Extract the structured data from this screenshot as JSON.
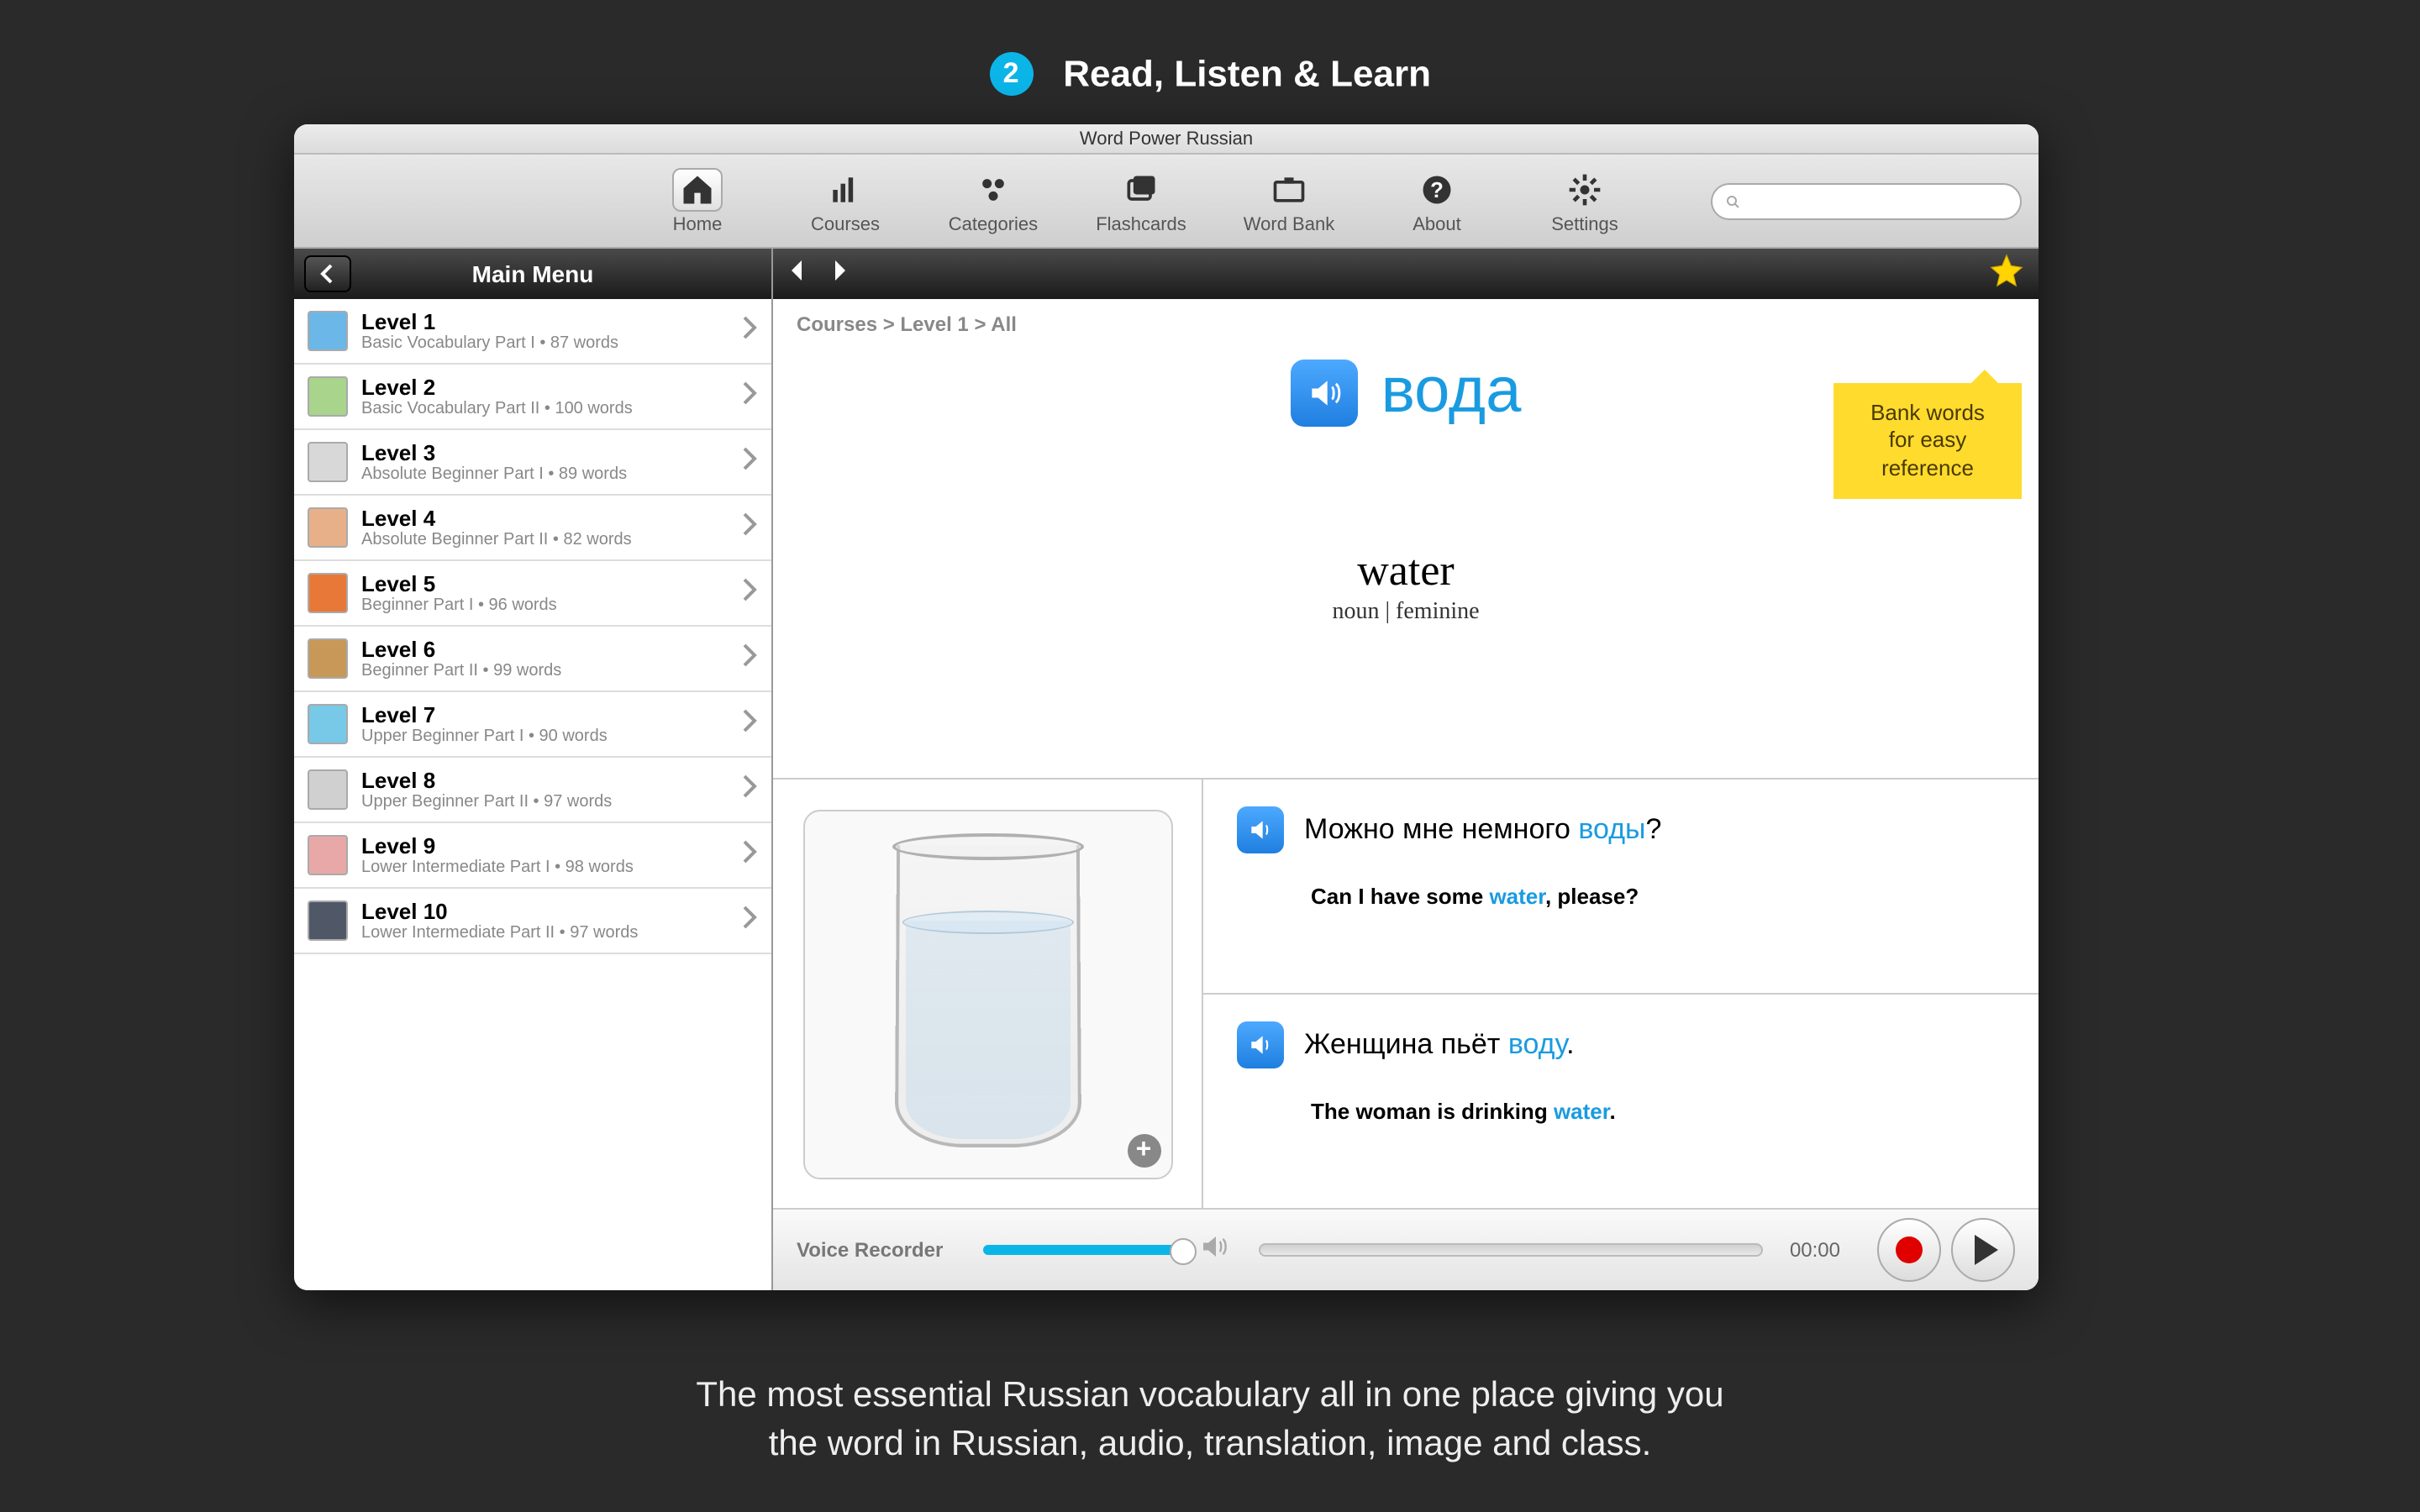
{
  "hero": {
    "step_number": "2",
    "title": "Read, Listen & Learn",
    "footer_line1": "The most essential Russian vocabulary all in one place giving you",
    "footer_line2": "the word in Russian, audio, translation, image and class."
  },
  "window": {
    "title": "Word Power Russian"
  },
  "toolbar": {
    "items": [
      {
        "label": "Home",
        "icon": "home"
      },
      {
        "label": "Courses",
        "icon": "courses"
      },
      {
        "label": "Categories",
        "icon": "categories"
      },
      {
        "label": "Flashcards",
        "icon": "flashcards"
      },
      {
        "label": "Word Bank",
        "icon": "wordbank"
      },
      {
        "label": "About",
        "icon": "about"
      },
      {
        "label": "Settings",
        "icon": "settings"
      }
    ],
    "search_placeholder": ""
  },
  "sidebar": {
    "title": "Main Menu",
    "levels": [
      {
        "title": "Level 1",
        "sub": "Basic Vocabulary Part I • 87 words"
      },
      {
        "title": "Level 2",
        "sub": "Basic Vocabulary Part II • 100 words"
      },
      {
        "title": "Level 3",
        "sub": "Absolute Beginner Part I • 89 words"
      },
      {
        "title": "Level 4",
        "sub": "Absolute Beginner Part II • 82 words"
      },
      {
        "title": "Level 5",
        "sub": "Beginner Part I • 96 words"
      },
      {
        "title": "Level 6",
        "sub": "Beginner Part II • 99 words"
      },
      {
        "title": "Level 7",
        "sub": "Upper Beginner Part I • 90 words"
      },
      {
        "title": "Level 8",
        "sub": "Upper Beginner Part II • 97 words"
      },
      {
        "title": "Level 9",
        "sub": "Lower Intermediate Part I • 98 words"
      },
      {
        "title": "Level 10",
        "sub": "Lower Intermediate Part II • 97 words"
      }
    ]
  },
  "main": {
    "breadcrumb": "Courses > Level 1 > All",
    "callout": "Bank words for easy reference",
    "word_ru": "вода",
    "translation": "water",
    "grammar": "noun | feminine",
    "examples": [
      {
        "ru_before": "Можно мне немного ",
        "ru_hl": "воды",
        "ru_after": "?",
        "en_before": "Can I have some ",
        "en_hl": "water",
        "en_after": ", please?"
      },
      {
        "ru_before": "Женщина пьёт ",
        "ru_hl": "воду",
        "ru_after": ".",
        "en_before": "The woman is drinking ",
        "en_hl": "water",
        "en_after": "."
      }
    ]
  },
  "recorder": {
    "label": "Voice Recorder",
    "time": "00:00"
  }
}
